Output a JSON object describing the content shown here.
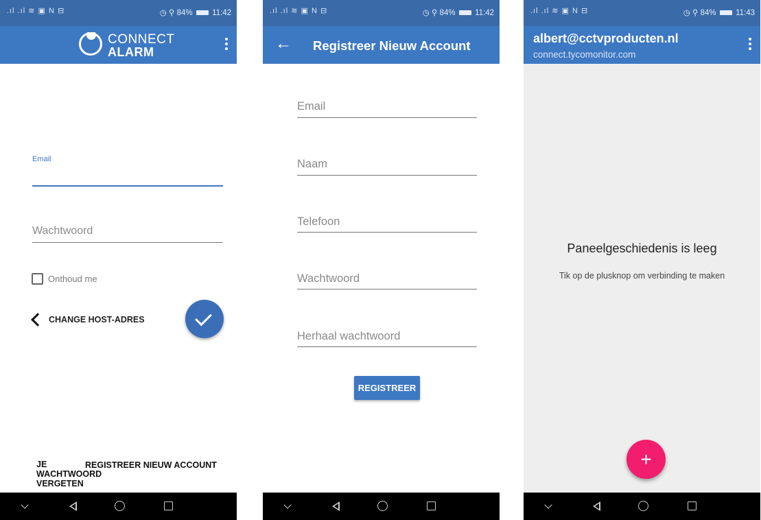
{
  "status_bars": [
    {
      "left": ".ıl .ıl ≋ ▣ N ⊟",
      "right_icons": "◷ ⚲",
      "battery": "84%",
      "time": "11:42"
    },
    {
      "left": ".ıl .ıl ≋ ▣ N ⊟",
      "right_icons": "◷ ⚲",
      "battery": "84%",
      "time": "11:42"
    },
    {
      "left": ".ıl .ıl ≋ ▣ N ⊟",
      "right_icons": "◷ ⚲",
      "battery": "84%",
      "time": "11:43"
    }
  ],
  "login": {
    "logo_line1": "CONNECT",
    "logo_line2": "ALARM",
    "email_label": "Email",
    "email_value": "",
    "password_placeholder": "Wachtwoord",
    "remember_label": "Onthoud me",
    "change_host_label": "CHANGE HOST-ADRES",
    "forgot_password_label": "JE WACHTWOORD VERGETEN",
    "register_link_label": "REGISTREER NIEUW ACCOUNT"
  },
  "register": {
    "title": "Registreer Nieuw Account",
    "fields": {
      "email": "Email",
      "name": "Naam",
      "phone": "Telefoon",
      "password": "Wachtwoord",
      "repeat_password": "Herhaal wachtwoord"
    },
    "submit_label": "REGISTREER"
  },
  "panels": {
    "account_email": "albert@cctvproducten.nl",
    "host": "connect.tycomonitor.com",
    "empty_title": "Paneelgeschiedenis is leeg",
    "empty_subtitle": "Tik op de plusknop om verbinding te maken",
    "add_button": "+"
  },
  "colors": {
    "app_bar": "#3d78c3",
    "status_bar": "#3a6ba8",
    "fab_check": "#3a6fb8",
    "fab_add": "#f21d6c"
  },
  "icons": {
    "menu": "more-vert",
    "back": "arrow-left",
    "confirm": "check",
    "nav": [
      "chevron-down",
      "back-triangle",
      "home-circle",
      "recent-square"
    ]
  }
}
